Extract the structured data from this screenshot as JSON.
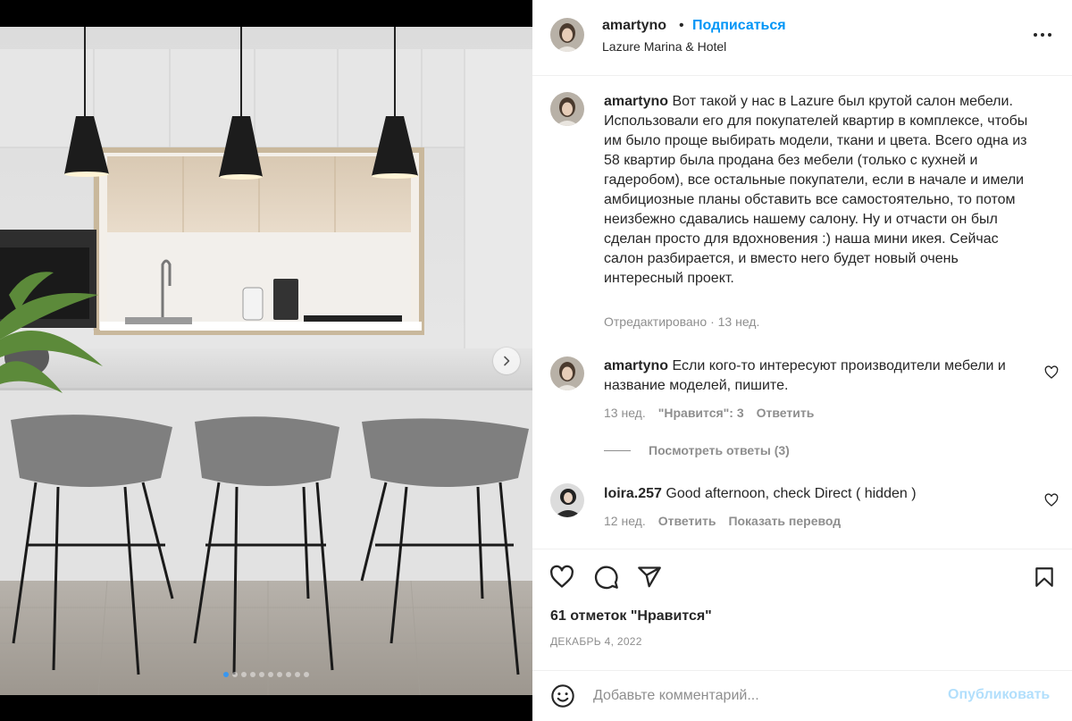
{
  "post": {
    "username": "amartyno",
    "dot": "•",
    "follow_label": "Подписаться",
    "location": "Lazure Marina & Hotel",
    "photo_count": 10,
    "active_photo": 1
  },
  "caption": {
    "username": "amartyno",
    "text": "Вот такой у нас в Lazure был крутой салон мебели. Использовали его для покупателей квартир в комплексе, чтобы им было проще выбирать модели, ткани и цвета. Всего одна из 58 квартир была продана без мебели (только с кухней и гадеробом), все остальные покупатели, если в начале и имели амбициозные планы обставить все самостоятельно, то потом неизбежно сдавались нашему салону. Ну и отчасти он был сделан просто для вдохновения :) наша мини икея. Сейчас салон разбирается, и вместо него будет новый очень интересный проект.",
    "meta": "Отредактировано · 13 нед."
  },
  "comments": [
    {
      "username": "amartyno",
      "text": "Если кого-то интересуют производители мебели и название моделей, пишите.",
      "age": "13 нед.",
      "likes": "\"Нравится\": 3",
      "reply": "Ответить",
      "view_replies": "Посмотреть ответы (3)"
    },
    {
      "username": "loira.257",
      "text": "Good afternoon, check Direct ( hidden )",
      "age": "12 нед.",
      "reply": "Ответить",
      "translate": "Показать перевод"
    }
  ],
  "likes_label": "61 отметок \"Нравится\"",
  "date_label": "ДЕКАБРЬ 4, 2022",
  "add_comment": {
    "placeholder": "Добавьте комментарий...",
    "publish_label": "Опубликовать"
  },
  "colors": {
    "link_blue": "#0095f6",
    "publish_disabled": "#b2dffc",
    "muted_text": "#8e8e8e"
  },
  "icons": [
    "chevron-right-icon",
    "more-icon",
    "heart-icon",
    "comment-icon",
    "share-icon",
    "bookmark-icon",
    "emoji-icon"
  ]
}
